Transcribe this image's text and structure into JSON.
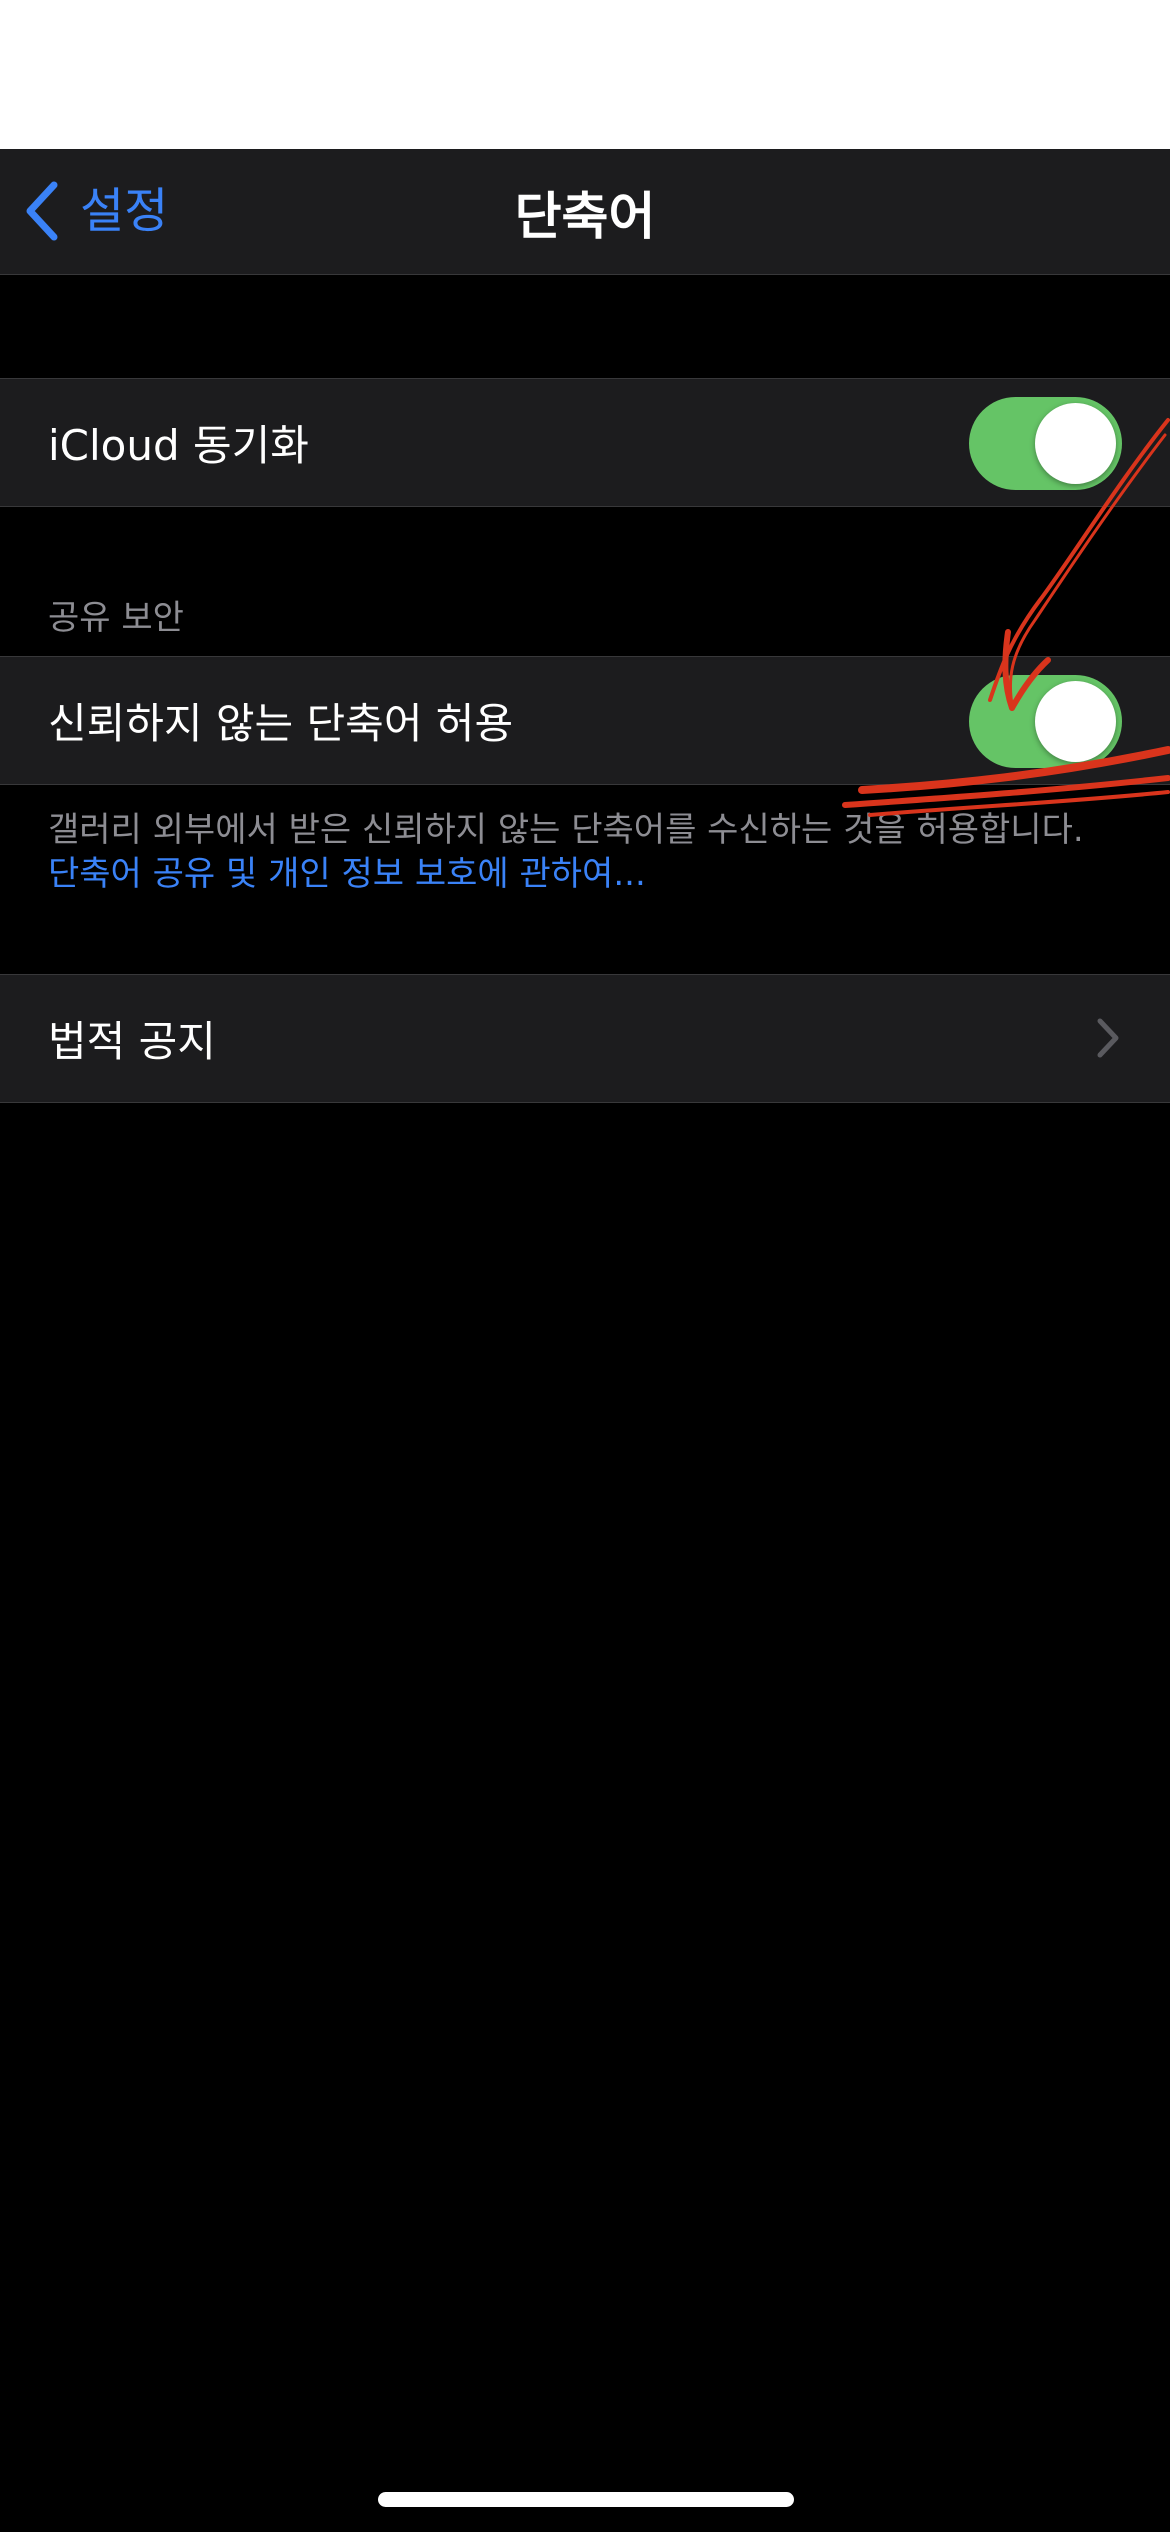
{
  "navbar": {
    "back_label": "설정",
    "title": "단축어"
  },
  "icloud_sync": {
    "label": "iCloud 동기화",
    "toggle_on": true
  },
  "sharing_security": {
    "header": "공유 보안",
    "allow_untrusted": {
      "label": "신뢰하지 않는 단축어 허용",
      "toggle_on": true
    },
    "footer_text": "갤러리 외부에서 받은 신뢰하지 않는 단축어를 수신하는 것을 허용합니다. ",
    "footer_link": "단축어 공유 및 개인 정보 보호에 관하여..."
  },
  "legal": {
    "label": "법적 공지"
  },
  "icons": {
    "back": "chevron-left-icon",
    "disclosure": "chevron-right-icon"
  },
  "colors": {
    "accent": "#3a82f7",
    "toggle_on": "#65c466",
    "cell_bg": "#1c1c1e",
    "background": "#000000",
    "secondary_text": "#8d8d93",
    "annotation_red": "#d9341c"
  }
}
